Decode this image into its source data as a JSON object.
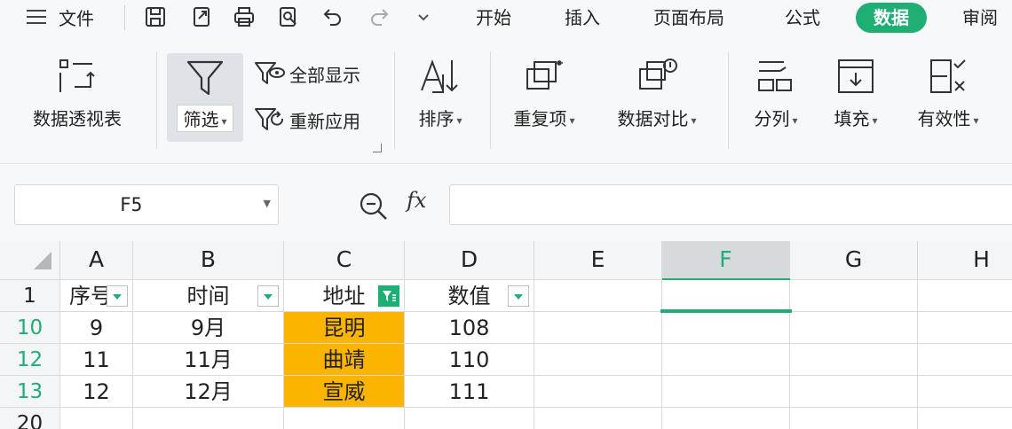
{
  "menu": {
    "file": "文件",
    "tabs": [
      "开始",
      "插入",
      "页面布局",
      "公式",
      "数据",
      "审阅"
    ],
    "active_tab_index": 4
  },
  "ribbon": {
    "pivot": "数据透视表",
    "filter": "筛选",
    "show_all": "全部显示",
    "reapply": "重新应用",
    "sort": "排序",
    "duplicates": "重复项",
    "compare": "数据对比",
    "split": "分列",
    "fill": "填充",
    "validity": "有效性"
  },
  "formula_bar": {
    "cell_ref": "F5",
    "fx": "fx",
    "formula": ""
  },
  "grid": {
    "columns": [
      "A",
      "B",
      "C",
      "D",
      "E",
      "F",
      "G",
      "H"
    ],
    "selected_column": "F",
    "row_headers": [
      "1",
      "10",
      "12",
      "13",
      "20"
    ],
    "headers": [
      "序号",
      "时间",
      "地址",
      "数值"
    ],
    "rows": [
      {
        "a": "9",
        "b": "9月",
        "c": "昆明",
        "d": "108"
      },
      {
        "a": "11",
        "b": "11月",
        "c": "曲靖",
        "d": "110"
      },
      {
        "a": "12",
        "b": "12月",
        "c": "宣威",
        "d": "111"
      }
    ]
  },
  "colors": {
    "accent": "#1fae73",
    "highlight": "#fbb400"
  },
  "icons": [
    "menu-icon",
    "save-icon",
    "export-icon",
    "print-icon",
    "preview-icon",
    "undo-icon",
    "redo-icon",
    "customize-icon",
    "pivot-icon",
    "filter-icon",
    "show-all-icon",
    "reapply-icon",
    "sort-icon",
    "duplicates-icon",
    "compare-icon",
    "split-icon",
    "fill-icon",
    "validity-icon",
    "zoom-icon"
  ]
}
